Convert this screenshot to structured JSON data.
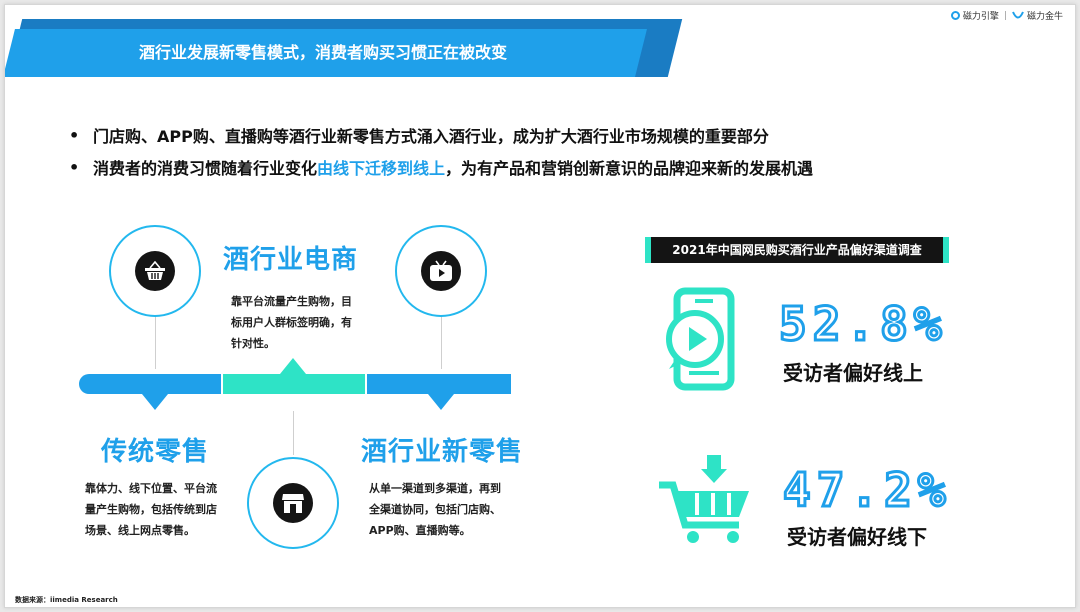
{
  "header": {
    "title": "酒行业发展新零售模式，消费者购买习惯正在被改变",
    "brand_left": "磁力引擎",
    "brand_right": "磁力金牛"
  },
  "bullets": [
    {
      "marker": "•",
      "text": "门店购、APP购、直播购等酒行业新零售方式涌入酒行业，成为扩大酒行业市场规模的重要部分"
    },
    {
      "marker": "•",
      "before": "消费者的消费习惯随着行业变化",
      "highlight": "由线下迁移到线上",
      "after": "，为有产品和营销创新意识的品牌迎来新的发展机遇"
    }
  ],
  "channels": {
    "ecommerce": {
      "title": "酒行业电商",
      "desc_lines": [
        "靠平台流量产生购物，目",
        "标用户人群标签明确，有",
        "针对性。"
      ],
      "icon": "shopping-basket-icon"
    },
    "traditional": {
      "title": "传统零售",
      "desc_lines": [
        "靠体力、线下位置、平台流",
        "量产生购物，包括传统到店",
        "场景、线上网点零售。"
      ],
      "icon": "storefront-icon"
    },
    "new_retail": {
      "title": "酒行业新零售",
      "desc_lines": [
        "从单一渠道到多渠道，再到",
        "全渠道协同，包括门店购、",
        "APP购、直播购等。"
      ],
      "icon": "tv-play-icon"
    }
  },
  "survey": {
    "title": "2021年中国网民购买酒行业产品偏好渠道调查",
    "online": {
      "value": "52.8%",
      "label": "受访者偏好线上",
      "icon": "phone-video-icon"
    },
    "offline": {
      "value": "47.2%",
      "label": "受访者偏好线下",
      "icon": "shopping-cart-icon"
    }
  },
  "source": "数据来源：iimedia Research",
  "colors": {
    "blue": "#1fa0ea",
    "teal": "#2ee3c6",
    "dark": "#141414"
  }
}
